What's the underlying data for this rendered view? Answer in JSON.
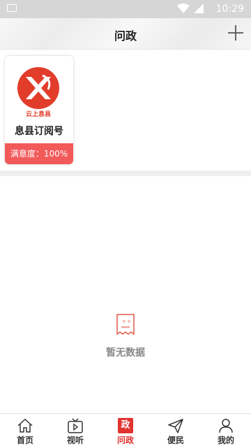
{
  "status_bar": {
    "time": "10:29"
  },
  "header": {
    "title": "问政",
    "add_icon": "plus-icon"
  },
  "card": {
    "name": "息县订阅号",
    "satisfaction": "满意度：100%",
    "logo_text": "云上息县",
    "logo_color": "#e23d2b"
  },
  "empty_state": {
    "icon": "empty-document-icon",
    "text": "暂无数据"
  },
  "tabbar": {
    "tabs": [
      {
        "label": "首页",
        "icon": "home-icon"
      },
      {
        "label": "视听",
        "icon": "tv-icon"
      },
      {
        "label": "问政",
        "icon": "zheng-badge-icon",
        "badge": "政",
        "active": true
      },
      {
        "label": "便民",
        "icon": "send-icon"
      },
      {
        "label": "我的",
        "icon": "person-icon"
      }
    ],
    "active_color": "#e0322f"
  }
}
